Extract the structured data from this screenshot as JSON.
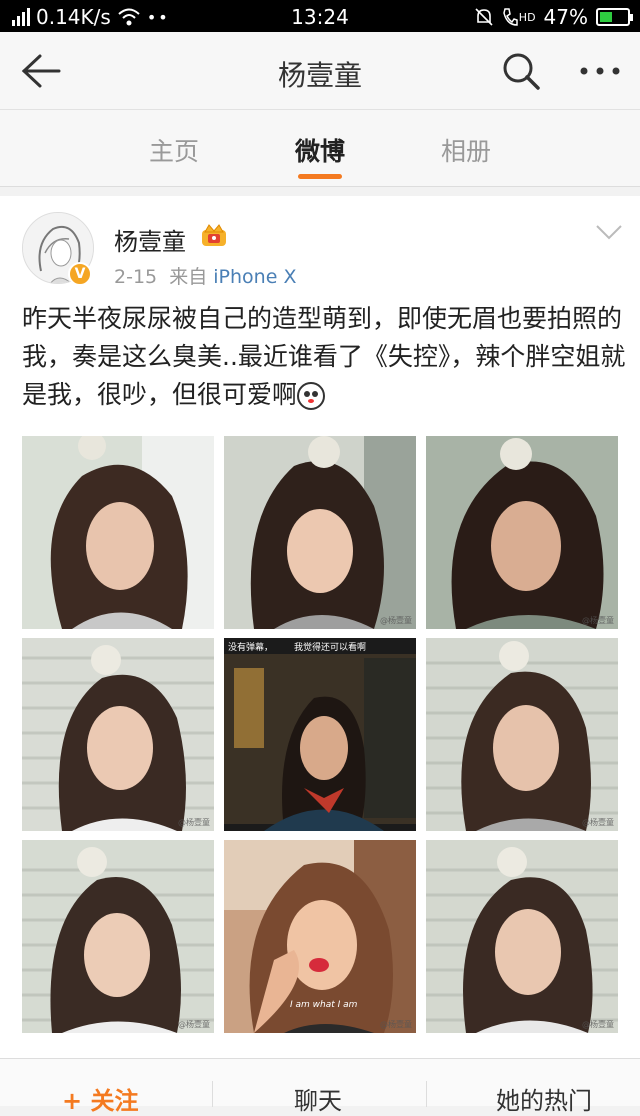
{
  "status_bar": {
    "net_speed": "0.14K/s",
    "time": "13:24",
    "battery": "47%",
    "hd_label": "HD"
  },
  "nav": {
    "title": "杨壹童"
  },
  "tabs": [
    {
      "label": "主页"
    },
    {
      "label": "微博"
    },
    {
      "label": "相册"
    }
  ],
  "post": {
    "author": "杨壹童",
    "date": "2-15",
    "source_prefix": "来自",
    "source": "iPhone X",
    "text": "昨天半夜尿尿被自己的造型萌到，即使无眉也要拍照的我，奏是这么臭美..最近谁看了《失控》，辣个胖空姐就是我，很吵，但很可爱啊",
    "photos": [
      {
        "watermark": ""
      },
      {
        "watermark": "@杨壹童"
      },
      {
        "watermark": "@杨壹童"
      },
      {
        "watermark": "@杨壹童"
      },
      {
        "caption_left": "没有弹幕，",
        "caption_right": "我觉得还可以看啊"
      },
      {
        "watermark": "@杨壹童"
      },
      {
        "watermark": "@杨壹童"
      },
      {
        "overlay_text": "I am what I am",
        "watermark": "@杨壹童"
      },
      {
        "watermark": "@杨壹童"
      }
    ]
  },
  "bottom_bar": {
    "follow": "+ 关注",
    "chat": "聊天",
    "hot": "她的热门"
  }
}
